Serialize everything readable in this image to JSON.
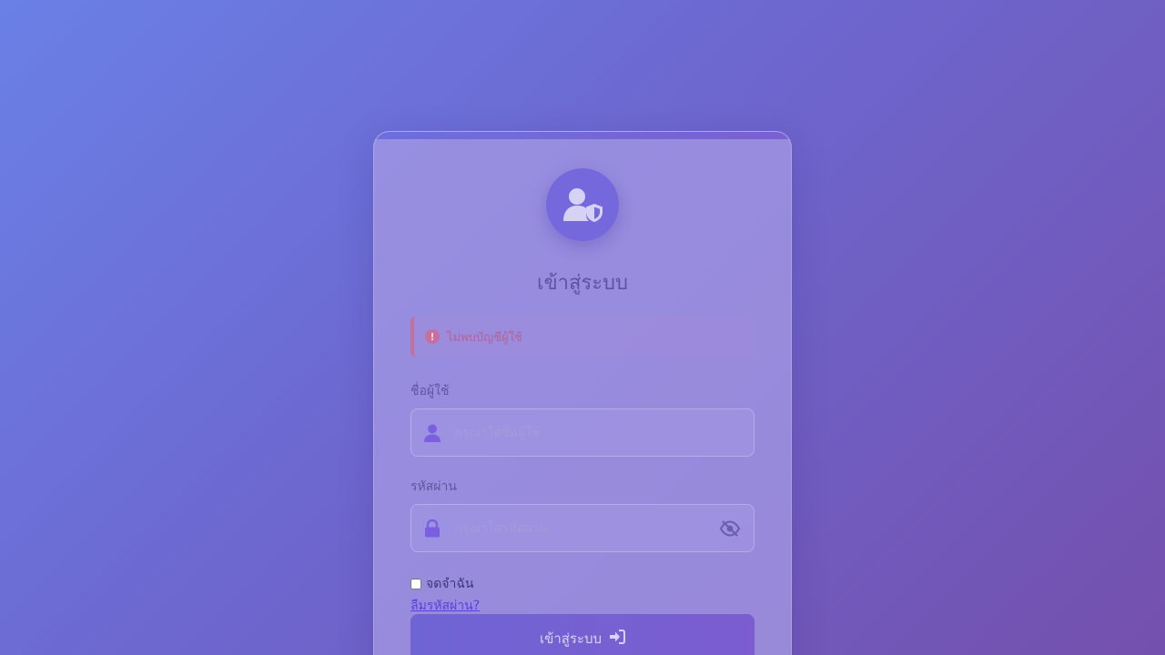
{
  "login": {
    "title": "เข้าสู่ระบบ",
    "alert": {
      "message": "ไม่พบบัญชีผู้ใช้",
      "color": "#c6709b"
    },
    "username": {
      "label": "ชื่อผู้ใช้",
      "placeholder": "กรุณาใส่ชื่อผู้ใช้",
      "value": ""
    },
    "password": {
      "label": "รหัสผ่าน",
      "placeholder": "กรุณาใส่รหัสผ่าน",
      "value": ""
    },
    "remember_label": "จดจำฉัน",
    "remember_checked": false,
    "forgot_label": "ลืมรหัสผ่าน?",
    "submit_label": "เข้าสู่ระบบ",
    "icons": {
      "avatar": "user-shield-icon",
      "alert": "exclamation-circle-icon",
      "username": "user-icon",
      "password": "lock-icon",
      "toggle": "eye-slash-icon",
      "submit": "sign-in-icon"
    },
    "colors": {
      "accent": "#7567dc",
      "background_start": "#6a80e6",
      "background_end": "#7450ad"
    }
  }
}
